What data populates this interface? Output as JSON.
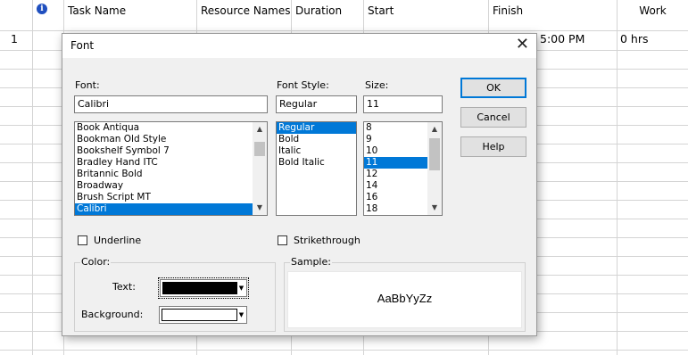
{
  "sheet": {
    "columns": [
      "Task Name",
      "Resource Names",
      "Duration",
      "Start",
      "Finish",
      "Work"
    ],
    "info_icon": "info-icon",
    "row": {
      "id": "1",
      "finish": "5:00 PM",
      "work": "0 hrs"
    }
  },
  "dialog": {
    "title": "Font",
    "close_icon": "close-icon",
    "font": {
      "label": "Font:",
      "value": "Calibri",
      "options": [
        "Book Antiqua",
        "Bookman Old Style",
        "Bookshelf Symbol 7",
        "Bradley Hand ITC",
        "Britannic Bold",
        "Broadway",
        "Brush Script MT",
        "Calibri"
      ],
      "selected": "Calibri"
    },
    "style": {
      "label": "Font Style:",
      "value": "Regular",
      "options": [
        "Regular",
        "Bold",
        "Italic",
        "Bold Italic"
      ],
      "selected": "Regular"
    },
    "size": {
      "label": "Size:",
      "value": "11",
      "options": [
        "8",
        "9",
        "10",
        "11",
        "12",
        "14",
        "16",
        "18"
      ],
      "selected": "11"
    },
    "buttons": {
      "ok": "OK",
      "cancel": "Cancel",
      "help": "Help"
    },
    "underline": {
      "label": "Underline",
      "checked": false
    },
    "strikethrough": {
      "label": "Strikethrough",
      "checked": false
    },
    "color": {
      "group_label": "Color:",
      "text_label": "Text:",
      "text_color": "#000000",
      "background_label": "Background:",
      "background_color": "#ffffff"
    },
    "sample": {
      "group_label": "Sample:",
      "text": "AaBbYyZz"
    }
  }
}
